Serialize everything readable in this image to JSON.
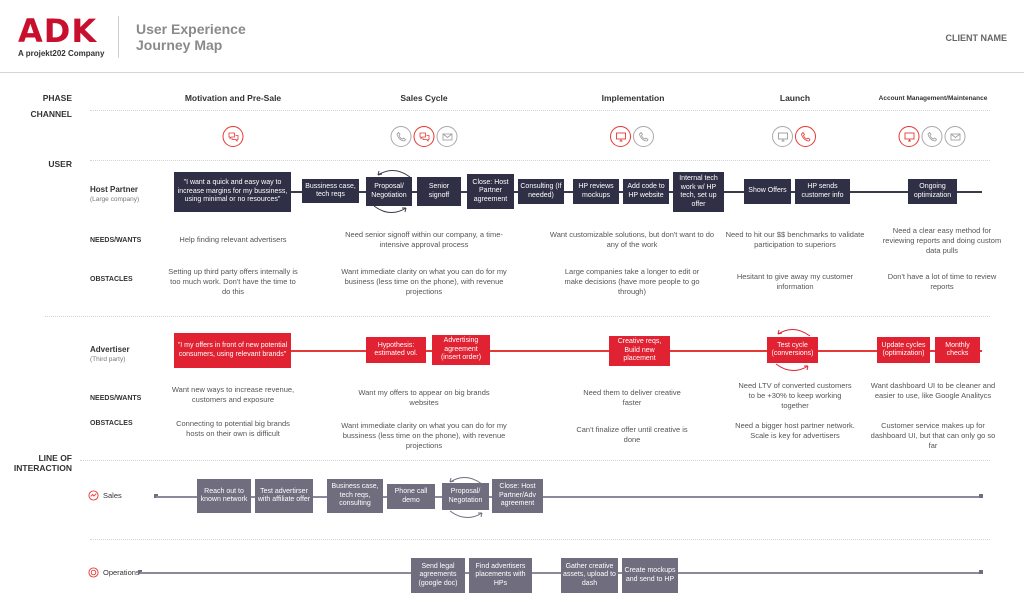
{
  "header": {
    "logo": "ADK",
    "logo_sub": "A projekt202 Company",
    "title_line1": "User Experience",
    "title_line2": "Journey Map",
    "client": "CLIENT NAME"
  },
  "labels": {
    "phase": "PHASE",
    "channel": "CHANNEL",
    "user": "USER",
    "needs": "NEEDS/WANTS",
    "obstacles": "OBSTACLES",
    "line_of_interaction_1": "LINE OF",
    "line_of_interaction_2": "INTERACTION"
  },
  "phases": [
    {
      "name": "Motivation and Pre-Sale",
      "channels": [
        {
          "icon": "chat-icon",
          "active": true
        }
      ]
    },
    {
      "name": "Sales Cycle",
      "channels": [
        {
          "icon": "phone-icon",
          "active": false
        },
        {
          "icon": "chat-icon",
          "active": true
        },
        {
          "icon": "mail-icon",
          "active": false
        }
      ]
    },
    {
      "name": "Implementation",
      "channels": [
        {
          "icon": "monitor-icon",
          "active": true
        },
        {
          "icon": "phone-icon",
          "active": false
        }
      ]
    },
    {
      "name": "Launch",
      "channels": [
        {
          "icon": "monitor-icon",
          "active": false
        },
        {
          "icon": "phone-icon",
          "active": true
        }
      ]
    },
    {
      "name": "Account Management/Maintenance",
      "channels": [
        {
          "icon": "monitor-icon",
          "active": true
        },
        {
          "icon": "phone-icon",
          "active": false
        },
        {
          "icon": "mail-icon",
          "active": false
        }
      ]
    }
  ],
  "host_partner": {
    "name": "Host Partner",
    "sub": "(Large company)",
    "steps": [
      "\"I want a quick and easy way to increase margins for my bussiness, using minimal or no resources\"",
      "Bussiness case, tech reqs",
      "Proposal/ Negotiation",
      "Senior signoff",
      "Close: Host Partner agreement",
      "Consulting (If needed)",
      "HP reviews mockups",
      "Add code to HP website",
      "Internal tech work w/ HP tech, set up offer",
      "Show Offers",
      "HP sends customer info",
      "Ongoing optimization"
    ],
    "needs": [
      "Help finding relevant advertisers",
      "Need senior signoff within our company, a time-intensive approval process",
      "Want customizable solutions, but don't want to do any of the work",
      "Need to hit our $$ benchmarks to validate participation to superiors",
      "Need a clear easy method for reviewing reports and doing custom data pulls"
    ],
    "obstacles": [
      "Setting up third party offers internally is too much work. Don't have the time to do this",
      "Want immediate clarity on what you can do for my business (less time on the phone), with revenue projections",
      "Large companies take a longer to edit or make  decisions (have more people to go through)",
      "Hesitant to give away my customer information",
      "Don't have a lot of time to review reports"
    ]
  },
  "advertiser": {
    "name": "Advertiser",
    "sub": "(Third party)",
    "steps": [
      "\"I my offers in front of new potential consumers, using relevant brands\"",
      "Hypothesis: estimated vol.",
      "Advertising agreement (insert order)",
      "Creative reqs, Build new placement",
      "Test cycle (conversions)",
      "Update cycles (optimization)",
      "Monthly checks"
    ],
    "needs": [
      "Want new ways to increase revenue, customers and exposure",
      "Want my offers to appear on big brands websites",
      "Need them to deliver creative faster",
      "Need LTV of converted customers to be +30% to keep working together",
      "Want dashboard UI to be cleaner and easier to use, like Google Analitycs"
    ],
    "obstacles": [
      "Connecting to potential big brands hosts on their own is difficult",
      "Want immediate clarity on what you can do for my bussiness (less time on the phone), with revenue projections",
      "Can't finalize offer until creative is done",
      "Need a bigger host partner network. Scale is key for advertisers",
      "Customer service makes up for dashboard UI, but that can only go so far"
    ]
  },
  "sales": {
    "name": "Sales",
    "steps": [
      "Reach out to known network",
      "Test advertirser with affiliate offer",
      "Business case, tech reqs, consulting",
      "Phone call demo",
      "Proposal/ Negotation",
      "Close: Host Partner/Adv agreement"
    ]
  },
  "operations": {
    "name": "Operations",
    "steps": [
      "Send legal agreements (google doc)",
      "Find advertisers placements with HPs",
      "Gather creative assets, upload to dash",
      "Create mockups and send to HP"
    ]
  },
  "colors": {
    "brand_red": "#c8102e",
    "advertiser_red": "#e02232",
    "host_dark": "#2f2f45",
    "interaction_grey": "#6f6d7e"
  }
}
